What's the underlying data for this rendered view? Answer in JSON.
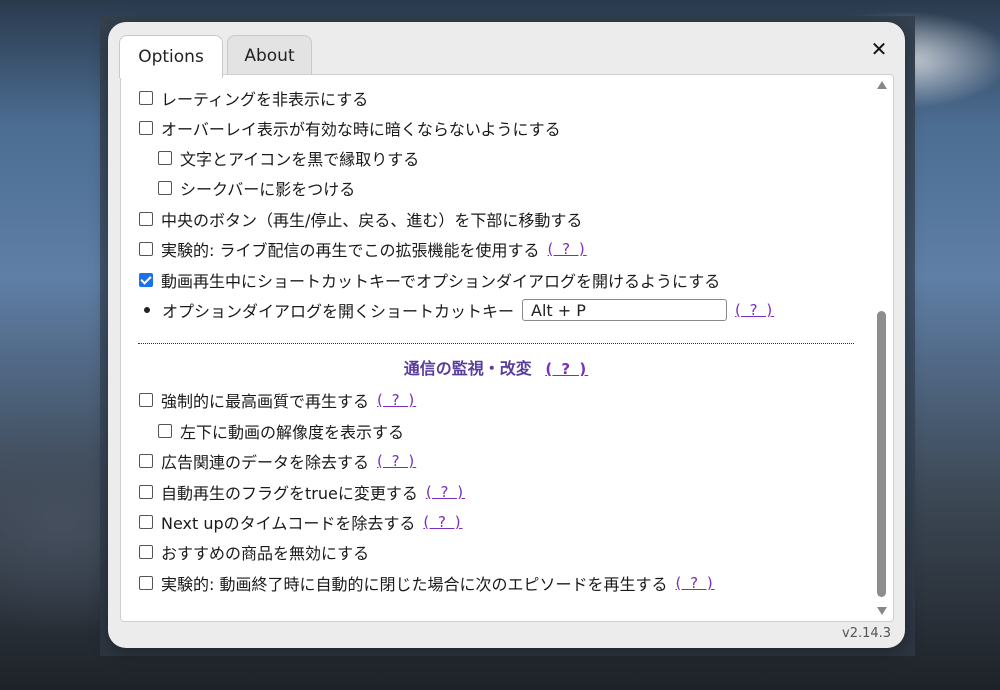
{
  "tabs": {
    "options": "Options",
    "about": "About"
  },
  "close_glyph": "✕",
  "options": [
    {
      "label": "レーティングを非表示にする",
      "checked": false
    },
    {
      "label": "オーバーレイ表示が有効な時に暗くならないようにする",
      "checked": false
    },
    {
      "label": "文字とアイコンを黒で縁取りする",
      "checked": false
    },
    {
      "label": "シークバーに影をつける",
      "checked": false
    },
    {
      "label": "中央のボタン（再生/停止、戻る、進む）を下部に移動する",
      "checked": false
    },
    {
      "label": "実験的: ライブ配信の再生でこの拡張機能を使用する",
      "checked": false,
      "help": "( ? )"
    },
    {
      "label": "動画再生中にショートカットキーでオプションダイアログを開けるようにする",
      "checked": true
    }
  ],
  "shortcut": {
    "label": "オプションダイアログを開くショートカットキー",
    "value": "Alt + P",
    "help": "( ? )"
  },
  "section": {
    "title": "通信の監視・改変",
    "help": "( ? )"
  },
  "network_options": [
    {
      "label": "強制的に最高画質で再生する",
      "checked": false,
      "help": "( ? )"
    },
    {
      "label": "左下に動画の解像度を表示する",
      "checked": false
    },
    {
      "label": "広告関連のデータを除去する",
      "checked": false,
      "help": "( ? )"
    },
    {
      "label": "自動再生のフラグをtrueに変更する",
      "checked": false,
      "help": "( ? )"
    },
    {
      "label": "Next upのタイムコードを除去する",
      "checked": false,
      "help": "( ? )"
    },
    {
      "label": "おすすめの商品を無効にする",
      "checked": false
    },
    {
      "label": "実験的: 動画終了時に自動的に閉じた場合に次のエピソードを再生する",
      "checked": false,
      "help": "( ? )"
    }
  ],
  "version": "v2.14.3",
  "colors": {
    "accent": "#1a73e8",
    "section_title": "#5a3d9e",
    "help_link": "#7a2fc2"
  }
}
